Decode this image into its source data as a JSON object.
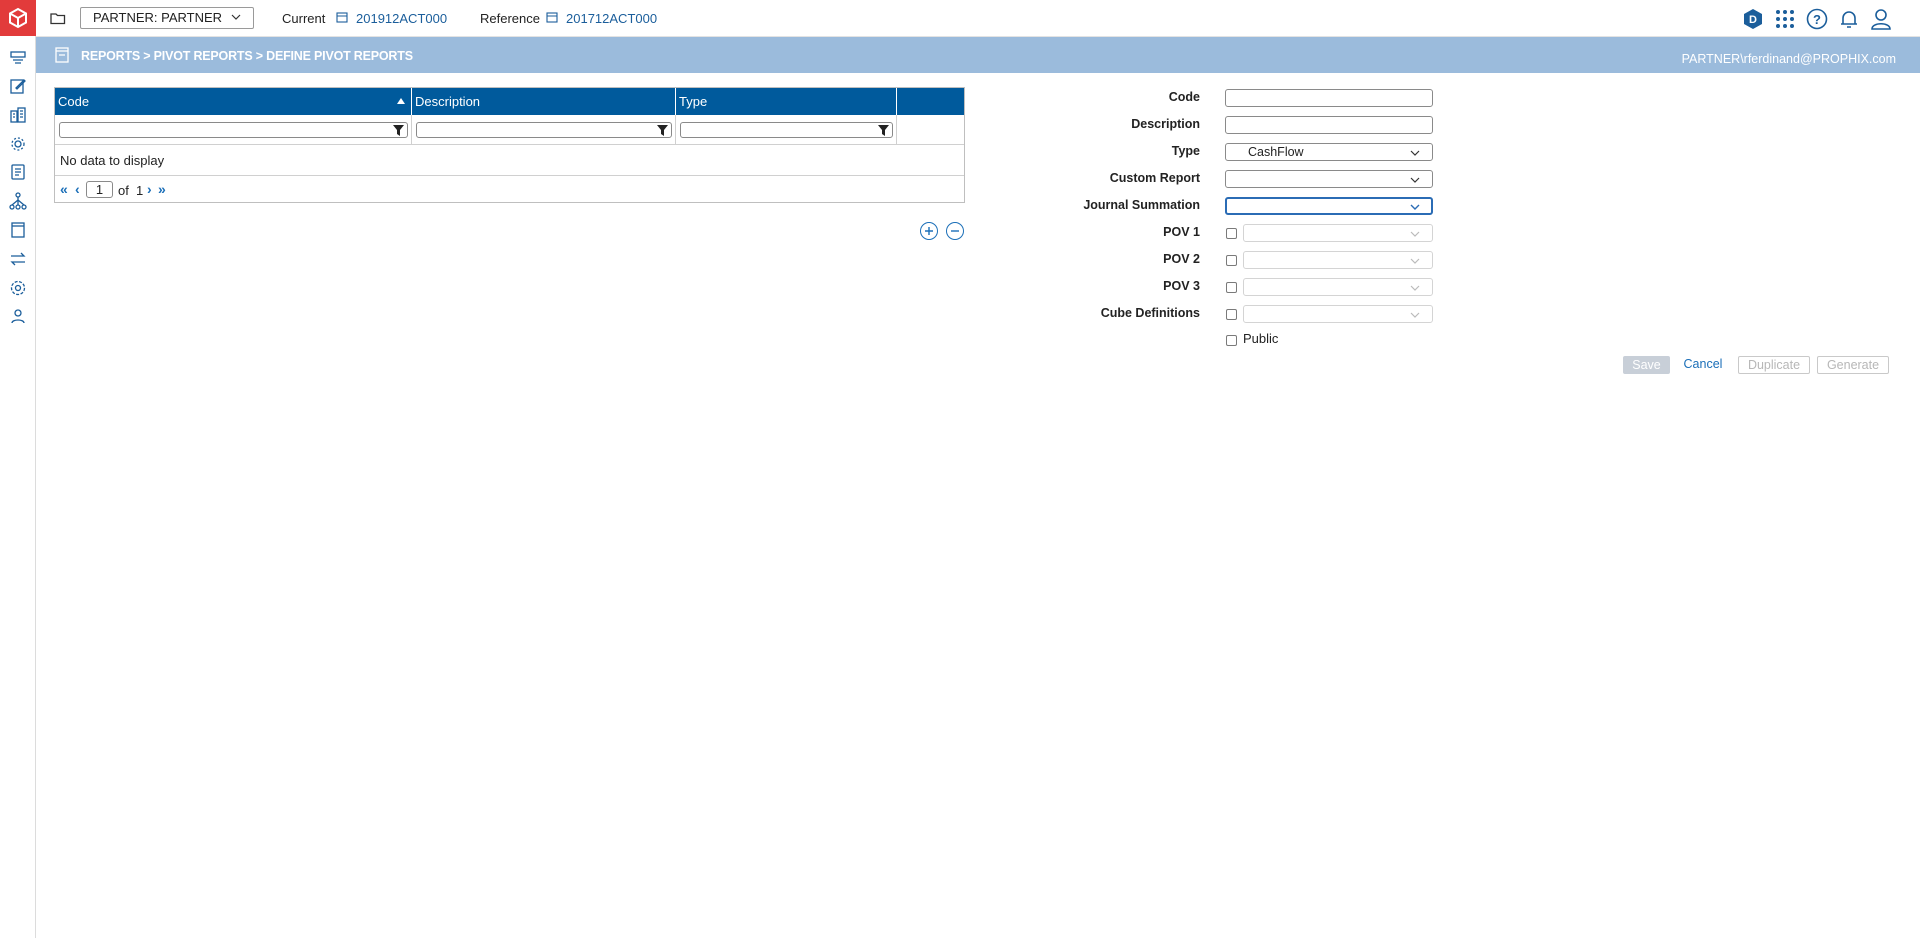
{
  "topbar": {
    "partner_select": "PARTNER: PARTNER",
    "current_label": "Current",
    "current_value": "201912ACT000",
    "reference_label": "Reference",
    "reference_value": "201712ACT000",
    "icons": [
      "d-badge-icon",
      "apps-grid-icon",
      "help-icon",
      "bell-icon",
      "user-icon"
    ]
  },
  "header": {
    "breadcrumb": "REPORTS > PIVOT REPORTS > DEFINE PIVOT REPORTS",
    "user": "PARTNER\\rferdinand@PROPHIX.com"
  },
  "sidebar": {
    "icons": [
      "workflow-icon",
      "edit-icon",
      "buildings-icon",
      "gear-network-icon",
      "report-icon",
      "hierarchy-icon",
      "book-icon",
      "transfer-icon",
      "settings-icon",
      "users-icon"
    ]
  },
  "grid": {
    "columns": [
      "Code",
      "Description",
      "Type"
    ],
    "empty_text": "No data to display",
    "pager": {
      "first": "«",
      "prev": "‹",
      "page": "1",
      "of": "of",
      "total": "1",
      "next": "›",
      "last": "»"
    }
  },
  "form": {
    "code_label": "Code",
    "description_label": "Description",
    "type_label": "Type",
    "type_value": "CashFlow",
    "custom_report_label": "Custom Report",
    "journal_summation_label": "Journal Summation",
    "pov1_label": "POV 1",
    "pov2_label": "POV 2",
    "pov3_label": "POV 3",
    "cube_definitions_label": "Cube Definitions",
    "public_label": "Public"
  },
  "actions": {
    "save": "Save",
    "cancel": "Cancel",
    "duplicate": "Duplicate",
    "generate": "Generate"
  },
  "colors": {
    "accent": "#005a9c",
    "band": "#9bbbdc",
    "logo": "#e23b3b",
    "link": "#1b6fb8"
  }
}
